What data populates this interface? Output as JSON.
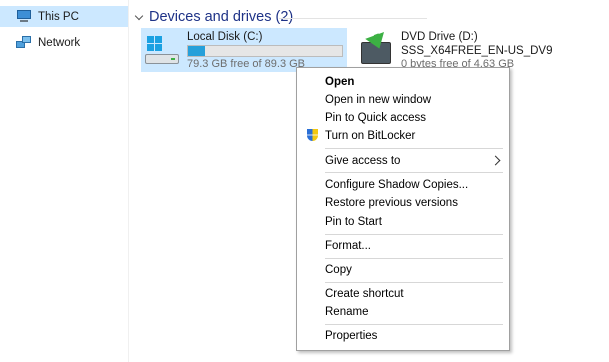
{
  "nav": {
    "items": [
      {
        "label": "This PC",
        "icon": "computer-icon",
        "selected": true
      },
      {
        "label": "Network",
        "icon": "network-icon",
        "selected": false
      }
    ]
  },
  "group": {
    "title": "Devices and drives (2)"
  },
  "drives": [
    {
      "name": "Local Disk (C:)",
      "free": "79.3 GB free of 89.3 GB",
      "used_fraction": 0.11,
      "icon": "hard-drive-icon",
      "selected": true
    },
    {
      "name": "DVD Drive (D:)",
      "label": "SSS_X64FREE_EN-US_DV9",
      "free": "0 bytes free of 4.63 GB",
      "icon": "dvd-drive-icon",
      "selected": false
    }
  ],
  "context_menu": {
    "items": [
      {
        "label": "Open",
        "bold": true
      },
      {
        "label": "Open in new window"
      },
      {
        "label": "Pin to Quick access"
      },
      {
        "label": "Turn on BitLocker",
        "icon": "shield-icon"
      },
      {
        "label": "Give access to",
        "submenu": true
      },
      {
        "label": "Configure Shadow Copies..."
      },
      {
        "label": "Restore previous versions"
      },
      {
        "label": "Pin to Start"
      },
      {
        "label": "Format..."
      },
      {
        "label": "Copy"
      },
      {
        "label": "Create shortcut"
      },
      {
        "label": "Rename"
      },
      {
        "label": "Properties"
      }
    ]
  },
  "colors": {
    "selection": "#cce8ff",
    "group_title": "#1e3287",
    "usage_bar": "#26a0da"
  }
}
